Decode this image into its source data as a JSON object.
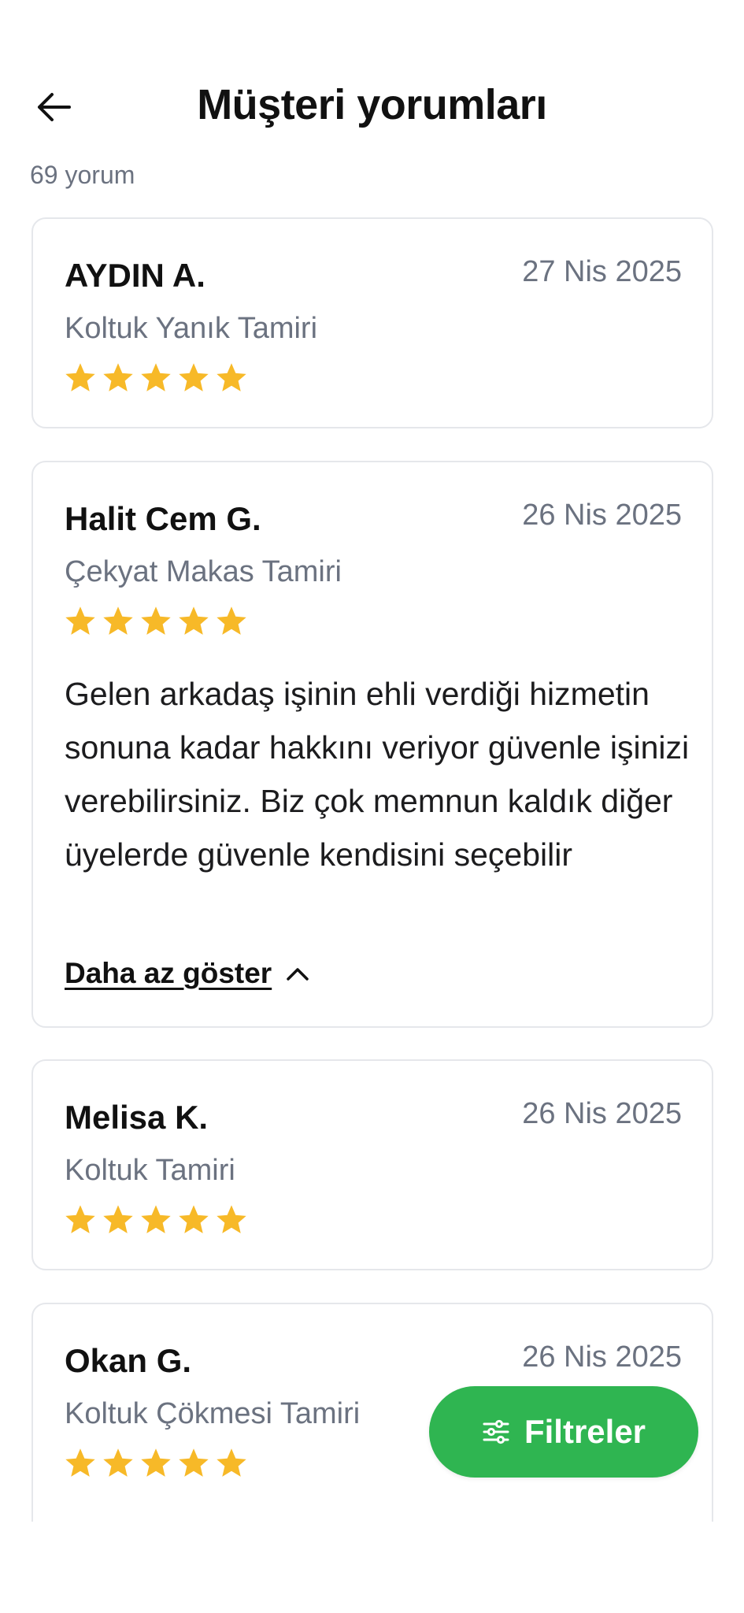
{
  "header": {
    "title": "Müşteri yorumları",
    "back_icon": "arrow-left-icon"
  },
  "summary": {
    "count_text": "69 yorum"
  },
  "colors": {
    "accent_green": "#2fb551",
    "star": "#f7b928",
    "muted_text": "#6b7280",
    "border": "#e5e7eb"
  },
  "reviews": [
    {
      "name": "AYDIN A.",
      "date": "27 Nis 2025",
      "service": "Koltuk Yanık Tamiri",
      "rating": 5
    },
    {
      "name": "Halit Cem G.",
      "date": "26 Nis 2025",
      "service": "Çekyat Makas Tamiri",
      "rating": 5,
      "comment": "Gelen arkadaş işinin ehli verdiği hizmetin sonuna kadar hakkını veriyor güvenle işinizi verebilirsiniz. Biz çok memnun kaldık diğer üyelerde güvenle kendisini seçebilir",
      "toggle_label": "Daha az göster"
    },
    {
      "name": "Melisa K.",
      "date": "26 Nis 2025",
      "service": "Koltuk Tamiri",
      "rating": 5
    },
    {
      "name": "Okan G.",
      "date": "26 Nis 2025",
      "service": "Koltuk Çökmesi Tamiri",
      "rating": 5
    }
  ],
  "filter_button": {
    "label": "Filtreler",
    "icon": "sliders-icon"
  }
}
